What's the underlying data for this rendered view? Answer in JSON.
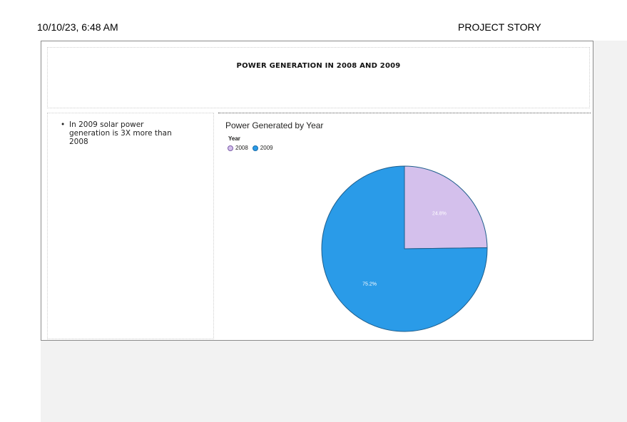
{
  "header": {
    "datetime": "10/10/23, 6:48 AM",
    "page_title": "PROJECT STORY"
  },
  "report": {
    "title": "POWER GENERATION IN 2008 AND 2009",
    "bullets": [
      {
        "bullet": "•",
        "text": "In 2009 solar power generation is 3X more than 2008"
      }
    ]
  },
  "chart_data": {
    "type": "pie",
    "title": "Power Generated by Year",
    "legend_title": "Year",
    "legend_position": "top-left",
    "categories": [
      "2008",
      "2009"
    ],
    "values": [
      24.8,
      75.2
    ],
    "labels": [
      "24.8%",
      "75.2%"
    ],
    "colors": [
      "#d4c0ec",
      "#2a9be8"
    ]
  }
}
